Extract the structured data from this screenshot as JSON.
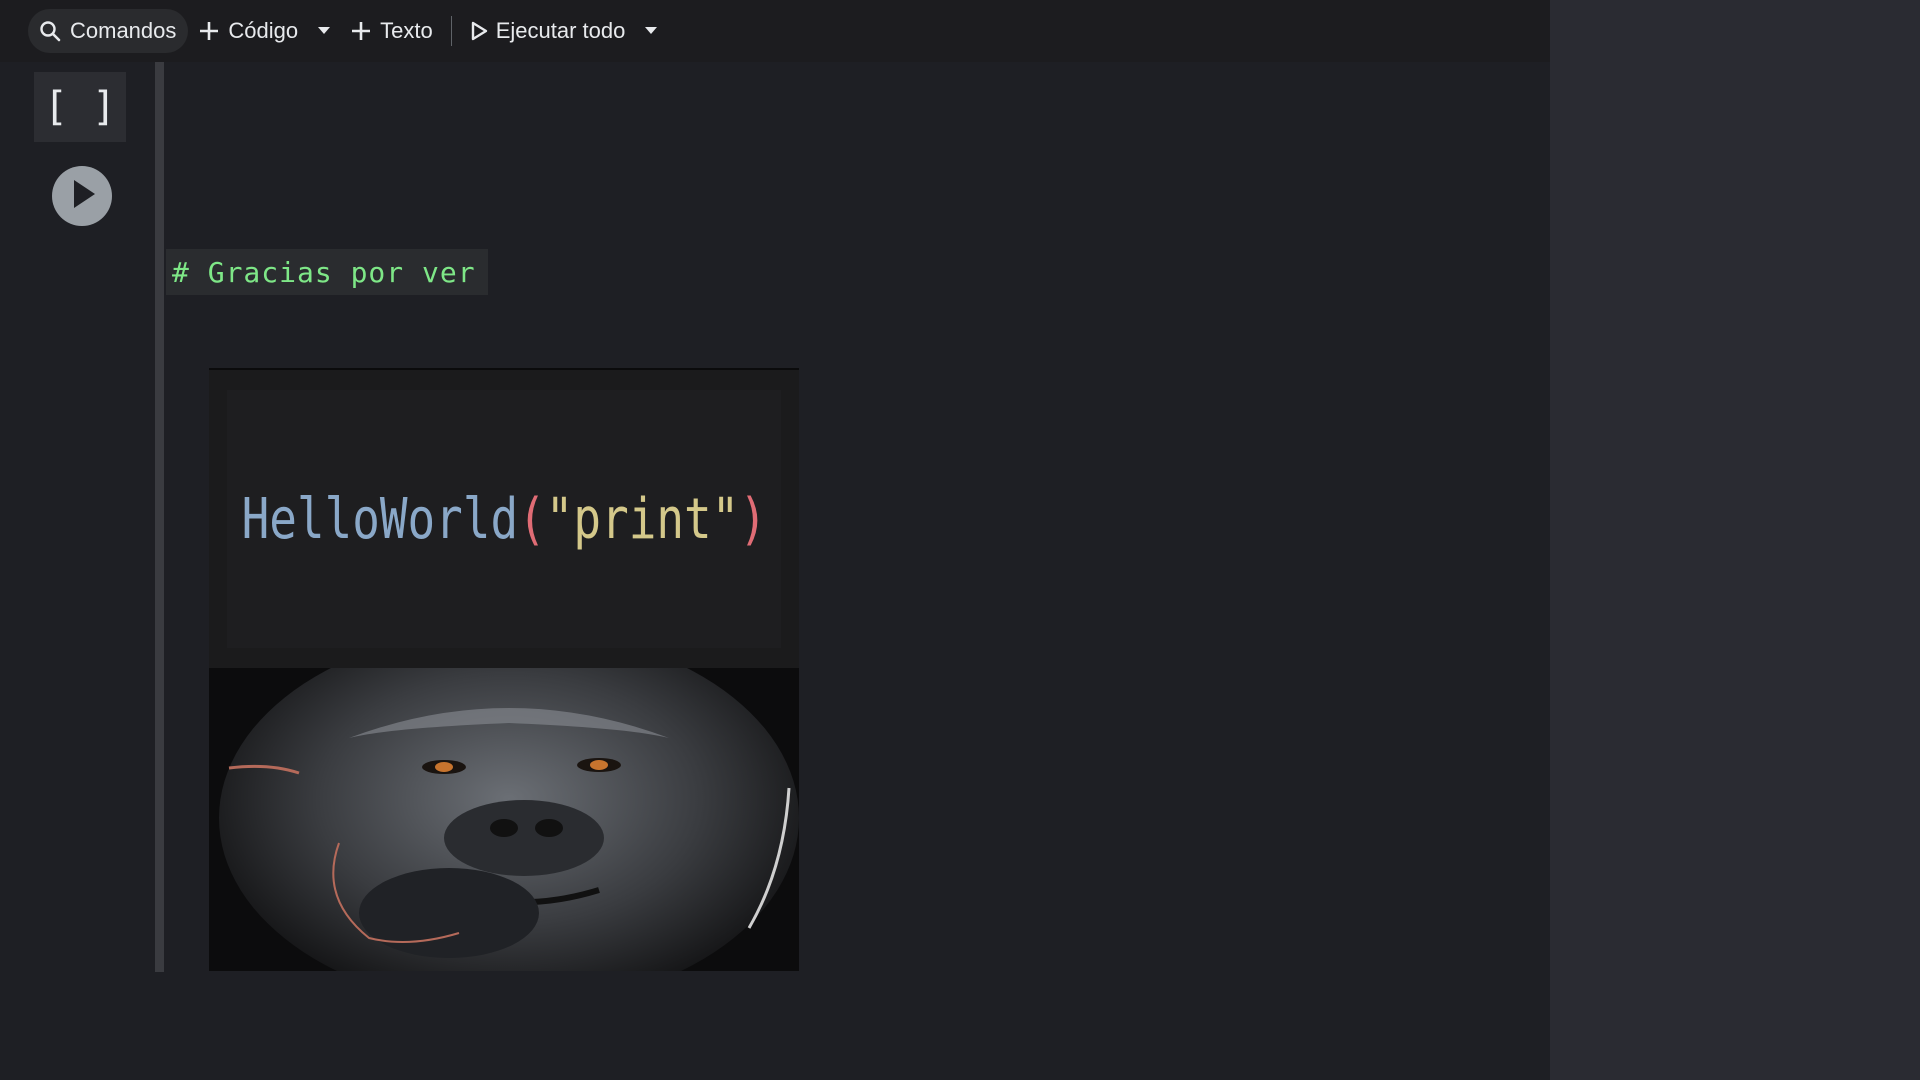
{
  "toolbar": {
    "search_label": "Comandos",
    "code_label": "Código",
    "text_label": "Texto",
    "run_all_label": "Ejecutar todo"
  },
  "cell": {
    "bracket_label": "[ ]",
    "markdown_heading": "# Gracias por ver"
  },
  "image_code": {
    "ident": "HelloWorld",
    "open_paren": "(",
    "string": "\"print\"",
    "close_paren": ")"
  },
  "colors": {
    "accent_green": "#7ee787",
    "code_ident": "#8aa8c8",
    "code_paren": "#e06c75",
    "code_string": "#d4c88a"
  }
}
